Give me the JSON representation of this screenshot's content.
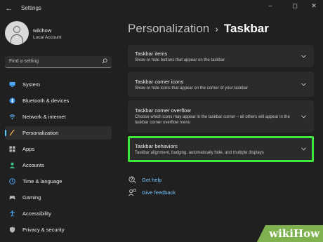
{
  "app": {
    "title": "Settings",
    "window_controls": [
      "–",
      "◻",
      "✕"
    ]
  },
  "profile": {
    "name": "wikihow",
    "subtitle": "Local Account"
  },
  "search": {
    "placeholder": "Find a setting"
  },
  "sidebar": {
    "items": [
      {
        "label": "System",
        "icon": "monitor-icon",
        "color": "#4aa8ff",
        "selected": false
      },
      {
        "label": "Bluetooth & devices",
        "icon": "bluetooth-icon",
        "color": "#2f8fe6",
        "selected": false
      },
      {
        "label": "Network & internet",
        "icon": "wifi-icon",
        "color": "#5fb6ff",
        "selected": false
      },
      {
        "label": "Personalization",
        "icon": "paintbrush-icon",
        "color": "#e0a84a",
        "selected": true
      },
      {
        "label": "Apps",
        "icon": "apps-icon",
        "color": "#b7b7b7",
        "selected": false
      },
      {
        "label": "Accounts",
        "icon": "person-icon",
        "color": "#37c48a",
        "selected": false
      },
      {
        "label": "Time & language",
        "icon": "globe-clock-icon",
        "color": "#4aa8ff",
        "selected": false
      },
      {
        "label": "Gaming",
        "icon": "gamepad-icon",
        "color": "#b7b7b7",
        "selected": false
      },
      {
        "label": "Accessibility",
        "icon": "accessibility-icon",
        "color": "#4aa8ff",
        "selected": false
      },
      {
        "label": "Privacy & security",
        "icon": "shield-icon",
        "color": "#b7b7b7",
        "selected": false
      }
    ]
  },
  "breadcrumb": {
    "parent": "Personalization",
    "separator": "›",
    "current": "Taskbar"
  },
  "cards": [
    {
      "title": "Taskbar items",
      "desc": "Show or hide buttons that appear on the taskbar",
      "highlighted": false
    },
    {
      "title": "Taskbar corner icons",
      "desc": "Show or hide icons that appear on the corner of your taskbar",
      "highlighted": false
    },
    {
      "title": "Taskbar corner overflow",
      "desc": "Choose which icons may appear in the taskbar corner – all others will appear in the taskbar corner overflow menu",
      "highlighted": false
    },
    {
      "title": "Taskbar behaviors",
      "desc": "Taskbar alignment, badging, automatically hide, and multiple displays",
      "highlighted": true
    }
  ],
  "links": {
    "help": "Get help",
    "feedback": "Give feedback"
  },
  "watermark": {
    "text": "wikiHow"
  },
  "colors": {
    "accent": "#60cdff",
    "highlight": "#3ce83a",
    "link": "#76c6ff",
    "background": "#202020",
    "card": "#2b2b2b"
  }
}
